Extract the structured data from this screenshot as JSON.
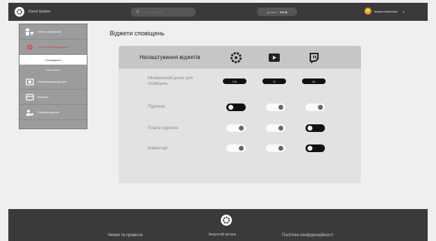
{
  "header": {
    "brand": "Donut System",
    "search_placeholder": "Пошук мітки",
    "balance_label": "Донати:",
    "balance_value": "200 ₴",
    "user_name": "Maryna Maslovska",
    "user_initial": "M"
  },
  "sidebar": {
    "items": [
      {
        "label": "Панель керування",
        "active": false,
        "icon": "dashboard-icon"
      },
      {
        "label": "Налаштування віджетів",
        "active": true,
        "icon": "settings-icon"
      },
      {
        "label": "Налаштування донатів",
        "active": false,
        "icon": "donation-settings-icon"
      },
      {
        "label": "Виплати",
        "active": false,
        "icon": "payout-icon"
      },
      {
        "label": "Сторінка донатів",
        "active": false,
        "icon": "donation-page-icon"
      }
    ],
    "subitems": [
      "Сповіщення",
      "Міні-шкала"
    ]
  },
  "main": {
    "title": "Віджети сповіщень",
    "panel_title": "Налаштування віджетів",
    "columns": [
      "donut-system-icon",
      "youtube-icon",
      "twitch-icon"
    ],
    "min_donation_label": "Мінімальний донат для сповіщень",
    "min_donation_values": [
      "100",
      "10",
      "50"
    ],
    "rows": [
      {
        "label": "Підписки",
        "states": [
          true,
          false,
          false
        ]
      },
      {
        "label": "Платні підписки",
        "states": [
          false,
          false,
          true
        ]
      },
      {
        "label": "Коментарі",
        "states": [
          false,
          false,
          true
        ]
      }
    ]
  },
  "footer": {
    "terms": "Умови та правила",
    "feedback": "Зворотній зв'язок",
    "privacy": "Політика конфіденційності"
  },
  "colors": {
    "accent": "#e04040",
    "dark": "#3a3a3a",
    "avatar": "#f0a020"
  }
}
